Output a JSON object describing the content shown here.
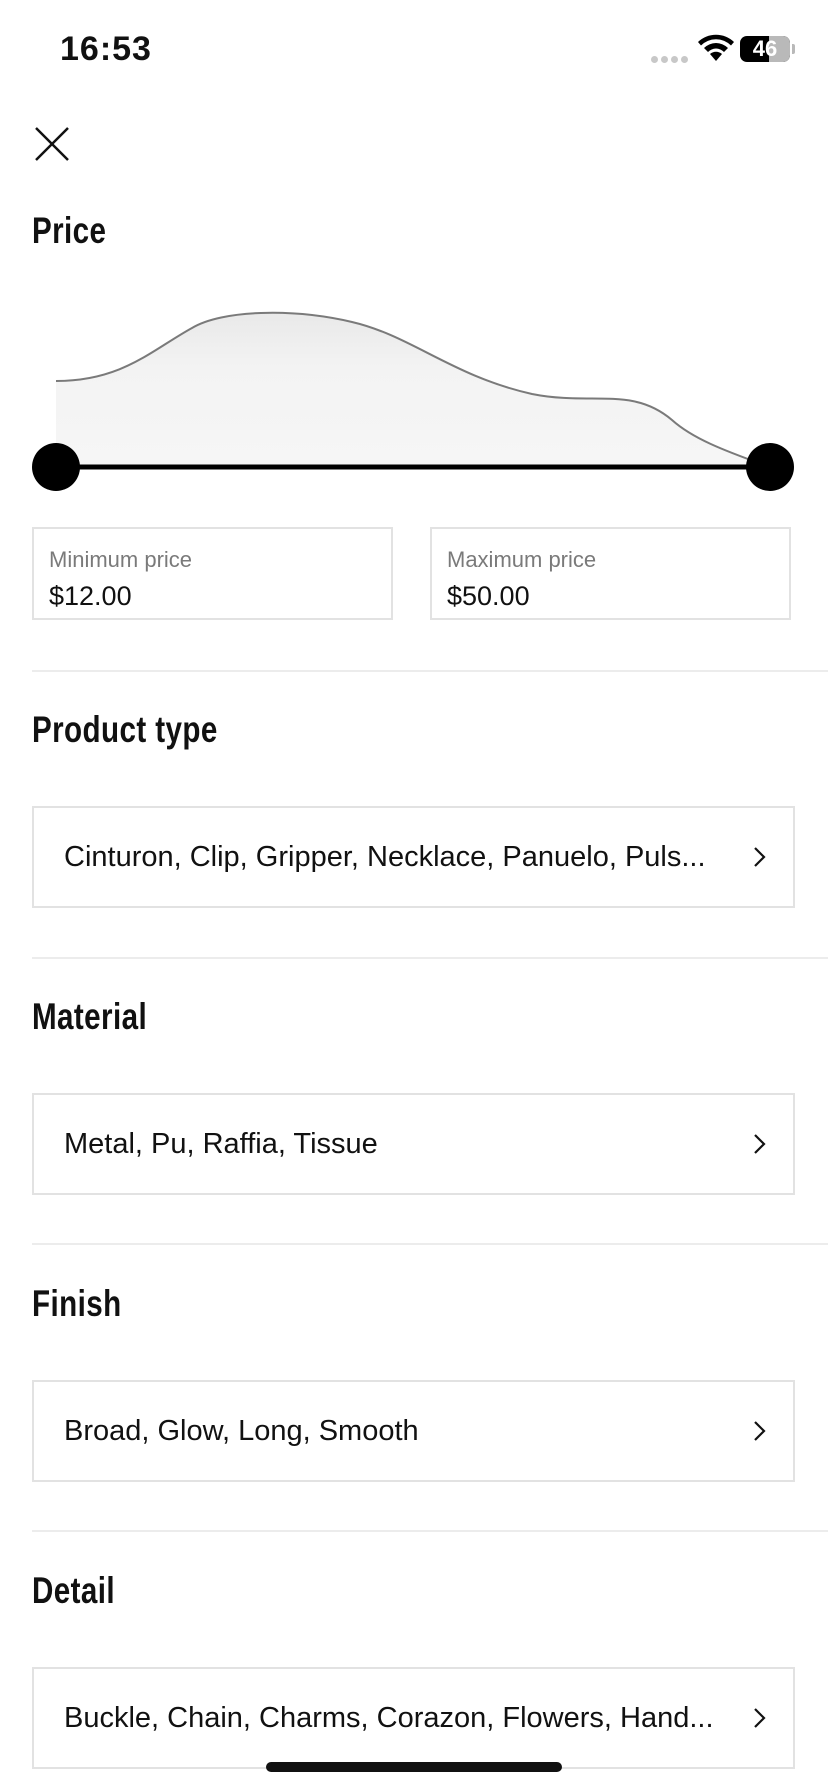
{
  "status_bar": {
    "time": "16:53",
    "battery_level": "46"
  },
  "icons": {
    "close": "close-icon",
    "wifi": "wifi-icon",
    "battery": "battery-icon",
    "chevron": "chevron-right-icon"
  },
  "price": {
    "title": "Price",
    "min_label": "Minimum price",
    "min_value": "$12.00",
    "max_label": "Maximum price",
    "max_value": "$50.00",
    "range_selected": [
      0,
      1
    ]
  },
  "product_type": {
    "title": "Product type",
    "value": "Cinturon, Clip, Gripper, Necklace, Panuelo, Puls..."
  },
  "material": {
    "title": "Material",
    "value": "Metal, Pu, Raffia, Tissue"
  },
  "finish": {
    "title": "Finish",
    "value": "Broad, Glow, Long, Smooth"
  },
  "detail": {
    "title": "Detail",
    "value": "Buckle, Chain, Charms, Corazon, Flowers, Hand..."
  },
  "colors": {
    "accent": "#000000",
    "border": "#e2e2e2",
    "divider": "#ececec",
    "muted_text": "#7a7a7a"
  }
}
